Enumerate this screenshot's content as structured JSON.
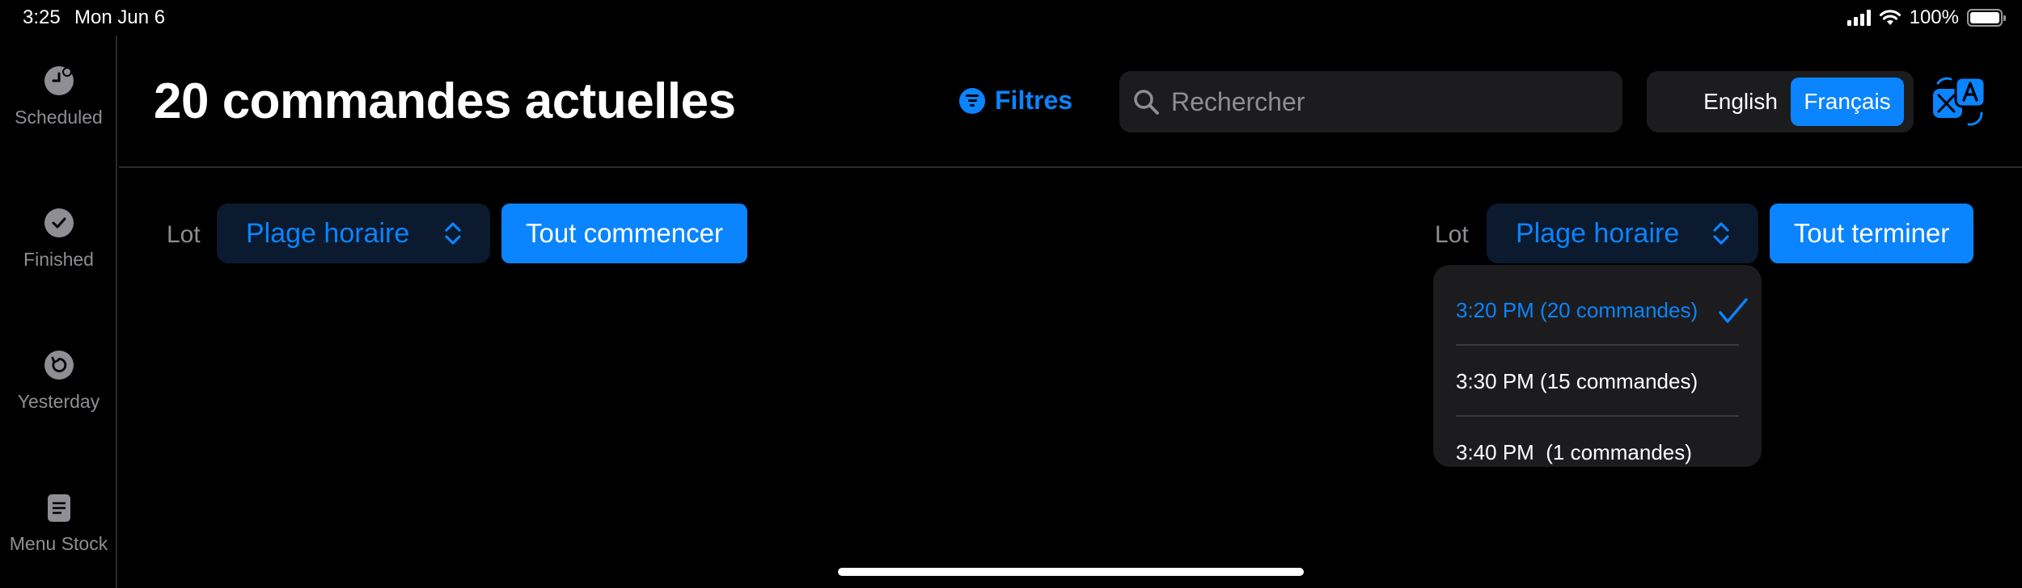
{
  "status_bar": {
    "time": "3:25",
    "date": "Mon Jun 6",
    "battery": "100%"
  },
  "sidebar": {
    "items": [
      {
        "label": "Scheduled",
        "icon": "clock-badge-icon"
      },
      {
        "label": "Finished",
        "icon": "checkmark-seal-icon"
      },
      {
        "label": "Yesterday",
        "icon": "history-icon"
      },
      {
        "label": "Menu Stock",
        "icon": "document-icon"
      }
    ]
  },
  "header": {
    "title": "20 commandes actuelles",
    "filter_label": "Filtres",
    "search_placeholder": "Rechercher",
    "language": {
      "options": [
        "English",
        "Français"
      ],
      "selected": "Français"
    }
  },
  "batches": {
    "left": {
      "lot_label": "Lot",
      "picker_label": "Plage horaire",
      "action_label": "Tout commencer"
    },
    "right": {
      "lot_label": "Lot",
      "picker_label": "Plage horaire",
      "action_label": "Tout terminer",
      "dropdown": {
        "options": [
          {
            "label": "3:20 PM (20 commandes)",
            "selected": true
          },
          {
            "label": "3:30 PM (15 commandes)",
            "selected": false
          },
          {
            "label": "3:40 PM  (1 commandes)",
            "selected": false
          }
        ]
      }
    }
  },
  "colors": {
    "accent": "#0a84ff",
    "background": "#000000",
    "surface": "#1c1c1e",
    "muted": "#8e8e93"
  }
}
